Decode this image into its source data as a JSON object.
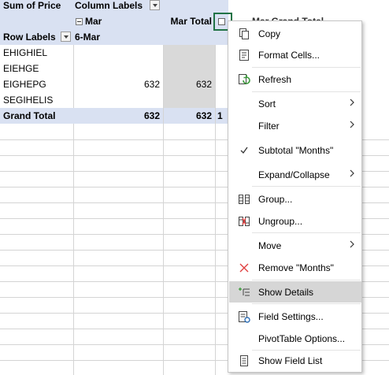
{
  "pivot": {
    "data_field": "Sum of Price",
    "column_labels": "Column Labels",
    "month_group": "Mar",
    "day_group": "6-Mar",
    "row_labels": "Row Labels",
    "month_total": "Mar Total",
    "hidden_header": "Mar Grand Total",
    "rows": [
      {
        "label": "EHIGHIEL",
        "day": "",
        "total": ""
      },
      {
        "label": "EIEHGE",
        "day": "",
        "total": ""
      },
      {
        "label": "EIGHEPG",
        "day": "632",
        "total": "632"
      },
      {
        "label": "SEGIHELIS",
        "day": "",
        "total": ""
      }
    ],
    "grand_total": {
      "label": "Grand Total",
      "day": "632",
      "total": "632",
      "partial": "1"
    }
  },
  "context_menu": {
    "items": [
      {
        "label": "Copy",
        "icon": "copy-icon"
      },
      {
        "label": "Format Cells...",
        "icon": "format-cells-icon"
      },
      {
        "label": "Refresh",
        "icon": "refresh-icon"
      },
      {
        "label": "Sort",
        "submenu": true
      },
      {
        "label": "Filter",
        "submenu": true
      },
      {
        "label": "Subtotal \"Months\"",
        "icon": "checkmark-icon",
        "checked": true
      },
      {
        "label": "Expand/Collapse",
        "submenu": true
      },
      {
        "label": "Group...",
        "icon": "group-icon"
      },
      {
        "label": "Ungroup...",
        "icon": "ungroup-icon"
      },
      {
        "label": "Move",
        "submenu": true
      },
      {
        "label": "Remove \"Months\"",
        "icon": "remove-x-icon"
      },
      {
        "label": "Show Details",
        "icon": "show-details-icon",
        "highlighted": true
      },
      {
        "label": "Field Settings...",
        "icon": "field-settings-icon"
      },
      {
        "label": "PivotTable Options...",
        "icon": ""
      },
      {
        "label": "Show Field List",
        "icon": "field-list-icon"
      }
    ]
  },
  "colors": {
    "header_band": "#d9e1f2",
    "gray_band": "#d9d9d9",
    "selection": "#217346",
    "remove_x": "#e04040",
    "refresh_green": "#3a9a3a"
  }
}
